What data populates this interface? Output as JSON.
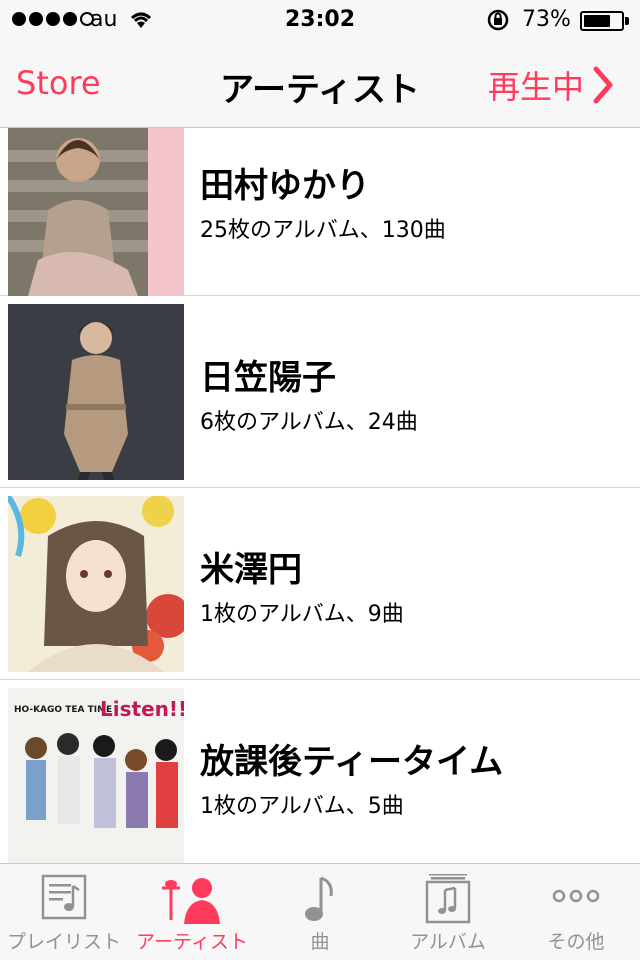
{
  "status": {
    "carrier": "au",
    "time": "23:02",
    "battery": "73%",
    "battery_level": 0.73
  },
  "nav": {
    "left": "Store",
    "title": "アーティスト",
    "right": "再生中"
  },
  "artists": [
    {
      "name": "田村ゆかり",
      "meta": "25枚のアルバム、130曲"
    },
    {
      "name": "日笠陽子",
      "meta": "6枚のアルバム、24曲"
    },
    {
      "name": "米澤円",
      "meta": "1枚のアルバム、9曲"
    },
    {
      "name": "放課後ティータイム",
      "meta": "1枚のアルバム、5曲"
    }
  ],
  "thumb_text": {
    "hokago": "HO-KAGO TEA TIME",
    "listen": "Listen!!"
  },
  "tabs": [
    {
      "label": "プレイリスト",
      "icon": "playlist-icon"
    },
    {
      "label": "アーティスト",
      "icon": "artist-icon",
      "active": true
    },
    {
      "label": "曲",
      "icon": "music-note-icon"
    },
    {
      "label": "アルバム",
      "icon": "album-icon"
    },
    {
      "label": "その他",
      "icon": "more-icon"
    }
  ],
  "colors": {
    "accent": "#ff3b5c",
    "inactive": "#929292"
  }
}
